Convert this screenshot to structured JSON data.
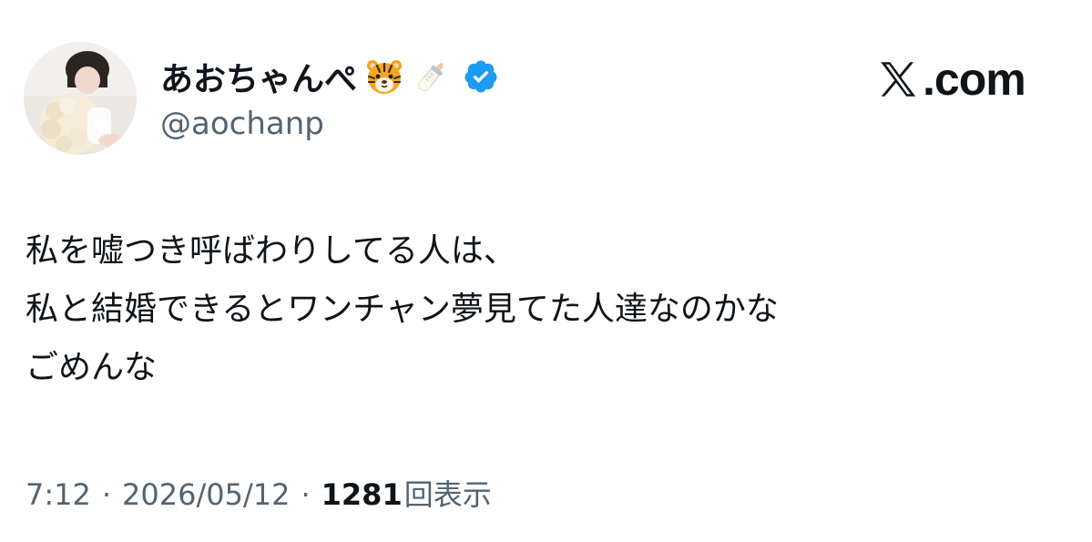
{
  "brand": {
    "label": ".com",
    "icon": "x-logo-icon"
  },
  "author": {
    "display_name": "あおちゃんぺ",
    "handle": "@aochanp",
    "emojis": [
      "tiger-face-icon",
      "baby-bottle-icon"
    ],
    "verified_icon": "verified-badge-icon"
  },
  "tweet": {
    "lines": [
      "私を嘘つき呼ばわりしてる人は、",
      "私と結婚できるとワンチャン夢見てた人達なのかな",
      "ごめんな"
    ]
  },
  "meta": {
    "time": "7:12",
    "separator": "·",
    "date": "2026/05/12",
    "views_count": "1281",
    "views_label": "回表示"
  },
  "colors": {
    "text": "#0f1419",
    "secondary": "#536471",
    "verified": "#1d9bf0"
  }
}
